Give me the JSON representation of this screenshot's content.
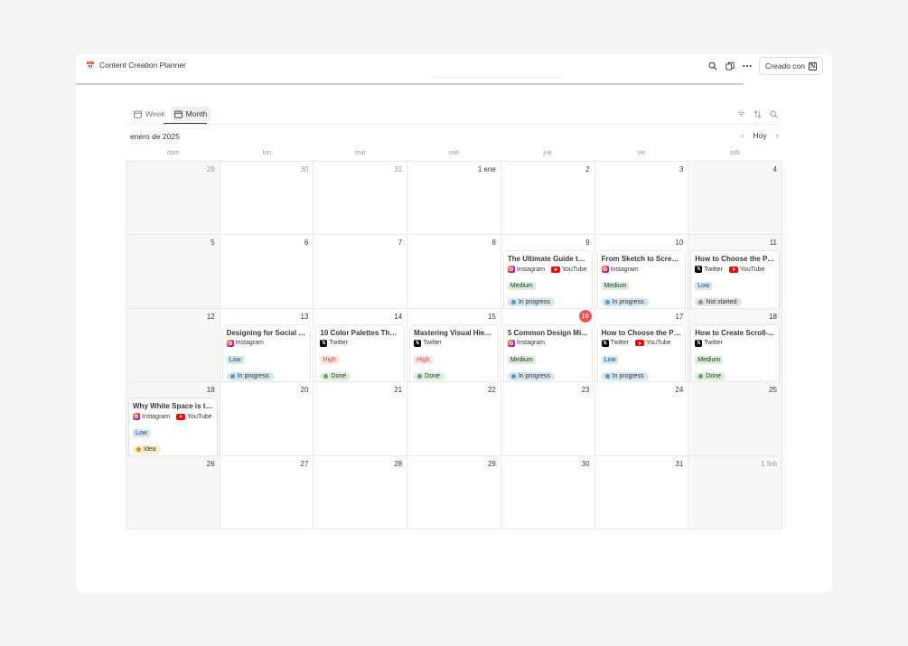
{
  "app": {
    "title": "Content Creation Planner",
    "title_icon": "calendar-emoji",
    "created_with": "Creado con"
  },
  "views": [
    {
      "label": "Week",
      "active": false
    },
    {
      "label": "Month",
      "active": true
    }
  ],
  "calendar": {
    "month_label": "enero de 2025",
    "today_label": "Hoy",
    "weekdays": [
      "dom",
      "lun",
      "mar",
      "mié",
      "jue",
      "vie",
      "sáb"
    ],
    "weeks": [
      [
        {
          "day": "29",
          "muted": true
        },
        {
          "day": "30",
          "muted": true
        },
        {
          "day": "31",
          "muted": true
        },
        {
          "day": "1 ene"
        },
        {
          "day": "2"
        },
        {
          "day": "3"
        },
        {
          "day": "4"
        }
      ],
      [
        {
          "day": "5"
        },
        {
          "day": "6"
        },
        {
          "day": "7"
        },
        {
          "day": "8"
        },
        {
          "day": "9",
          "event": {
            "title": "The Ultimate Guide to ...",
            "platforms": [
              "Instagram",
              "YouTube"
            ],
            "priority": "Medium",
            "status": "In progress"
          }
        },
        {
          "day": "10",
          "event": {
            "title": "From Sketch to Scree...",
            "platforms": [
              "Instagram"
            ],
            "priority": "Medium",
            "status": "In progress"
          }
        },
        {
          "day": "11",
          "event": {
            "title": "How to Choose the Pe...",
            "platforms": [
              "Twitter",
              "YouTube"
            ],
            "priority": "Low",
            "status": "Not started"
          }
        }
      ],
      [
        {
          "day": "12"
        },
        {
          "day": "13",
          "event": {
            "title": "Designing for Social M...",
            "platforms": [
              "Instagram"
            ],
            "priority": "Low",
            "status": "In progress"
          }
        },
        {
          "day": "14",
          "event": {
            "title": "10 Color Palettes That ...",
            "platforms": [
              "Twitter"
            ],
            "priority": "High",
            "status": "Done"
          }
        },
        {
          "day": "15",
          "event": {
            "title": "Mastering Visual Hiera...",
            "platforms": [
              "Twitter"
            ],
            "priority": "High",
            "status": "Done"
          }
        },
        {
          "day": "16",
          "today": true,
          "event": {
            "title": "5 Common Design Mi...",
            "platforms": [
              "Instagram"
            ],
            "priority": "Medium",
            "status": "In progress"
          }
        },
        {
          "day": "17",
          "event": {
            "title": "How to Choose the Pe...",
            "platforms": [
              "Twitter",
              "YouTube"
            ],
            "priority": "Low",
            "status": "In progress"
          }
        },
        {
          "day": "18",
          "event": {
            "title": "How to Create Scroll-...",
            "platforms": [
              "Twitter"
            ],
            "priority": "Medium",
            "status": "Done"
          }
        }
      ],
      [
        {
          "day": "19",
          "event": {
            "title": "Why White Space is th...",
            "platforms": [
              "Instagram",
              "YouTube"
            ],
            "priority": "Low",
            "status": "Idea"
          }
        },
        {
          "day": "20"
        },
        {
          "day": "21"
        },
        {
          "day": "22"
        },
        {
          "day": "23"
        },
        {
          "day": "24"
        },
        {
          "day": "25"
        }
      ],
      [
        {
          "day": "26"
        },
        {
          "day": "27"
        },
        {
          "day": "28"
        },
        {
          "day": "29"
        },
        {
          "day": "30"
        },
        {
          "day": "31"
        },
        {
          "day": "1 feb",
          "muted": true
        }
      ]
    ]
  },
  "styles": {
    "priority": {
      "Low": {
        "bg": "#d3e5ef",
        "fg": "#28456c"
      },
      "Medium": {
        "bg": "#dbeddb",
        "fg": "#1c3829"
      },
      "High": {
        "bg": "#ffe2dd",
        "fg": "#c4554d"
      }
    },
    "status": {
      "In progress": {
        "bg": "#d3e5ef",
        "dot": "#5b97bd"
      },
      "Done": {
        "bg": "#dbeddb",
        "dot": "#6c9b7d"
      },
      "Not started": {
        "bg": "#e3e2e0",
        "dot": "#91918e"
      },
      "Idea": {
        "bg": "#fdecc8",
        "dot": "#cb912f"
      }
    },
    "today_color": "#eb5757"
  }
}
